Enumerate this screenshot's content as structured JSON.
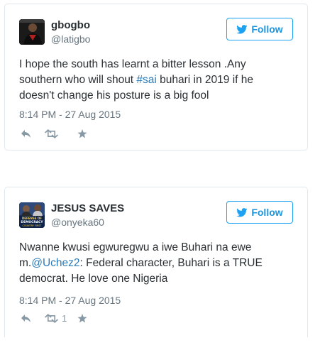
{
  "colors": {
    "link": "#2b7bb9",
    "follow": "#1da1f2",
    "meta": "#66757f",
    "icon": "#8899a6",
    "border": "#e1e8ed"
  },
  "tweets": [
    {
      "display_name": "gbogbo",
      "screen_name": "@latigbo",
      "avatar_icon": "user-avatar",
      "follow_label": "Follow",
      "follow_icon": "twitter-bird-icon",
      "text_lines": [
        {
          "before": "I hope the south has learnt a bitter lesson .Any",
          "link": "",
          "after": ""
        },
        {
          "before": "southern who will shout ",
          "link": "#sai",
          "after": " buhari in 2019 if he"
        },
        {
          "before": "doesn't  change his posture is a big fool",
          "link": "",
          "after": ""
        }
      ],
      "timestamp": "8:14 PM - 27 Aug 2015",
      "retweet_count": ""
    },
    {
      "display_name": "JESUS SAVES",
      "screen_name": "@onyeka60",
      "avatar_icon": "user-avatar",
      "avatar_text": [
        "DEFENSE OF",
        "DEMOCRACY",
        "COUNTRY FIRST"
      ],
      "follow_label": "Follow",
      "follow_icon": "twitter-bird-icon",
      "text_lines": [
        {
          "before": "Nwanne kwusi egwuregwu a iwe Buhari na ewe",
          "link": "",
          "after": ""
        },
        {
          "before": "m.",
          "link": "@Uchez2",
          "after": ": Federal character, Buhari is a TRUE"
        },
        {
          "before": "democrat.  He love one Nigeria",
          "link": "",
          "after": ""
        }
      ],
      "timestamp": "8:14 PM - 27 Aug 2015",
      "retweet_count": "1"
    }
  ]
}
